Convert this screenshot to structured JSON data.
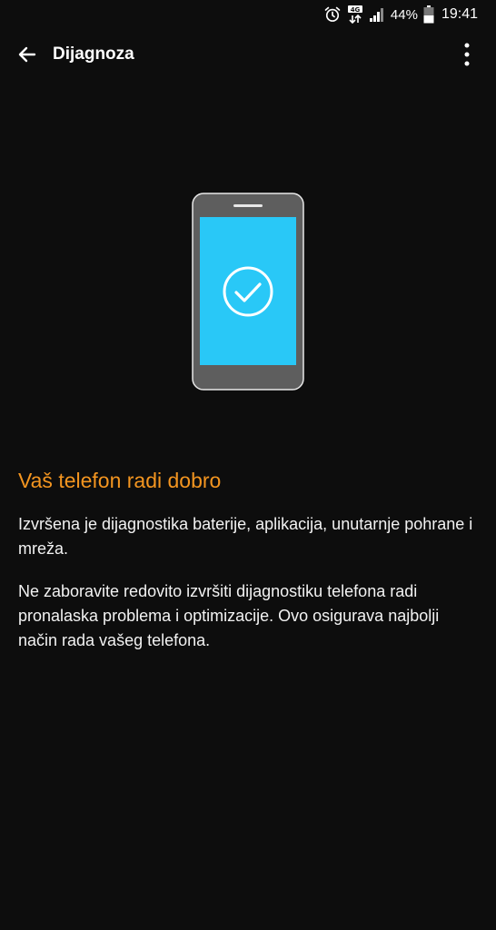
{
  "status_bar": {
    "icons": [
      "alarm-icon",
      "4g-signal-icon",
      "signal-bars-icon",
      "battery-icon"
    ],
    "network_label": "4G",
    "battery_percent": "44%",
    "time": "19:41"
  },
  "app_bar": {
    "title": "Dijagnoza",
    "back_icon": "arrow-left-icon",
    "menu_icon": "more-vertical-icon"
  },
  "illustration": {
    "screen_color": "#29c8f7",
    "body_color": "#5e5e5e",
    "icon": "check-circle-icon"
  },
  "result": {
    "headline": "Vaš telefon radi dobro",
    "headline_color": "#f39520",
    "paragraph_1": "Izvršena je dijagnostika baterije, aplikacija, unutarnje pohrane i mreža.",
    "paragraph_2": "Ne zaboravite redovito izvršiti dijagnostiku telefona radi pronalaska problema i optimizacije. Ovo osigurava najbolji način rada vašeg telefona."
  }
}
